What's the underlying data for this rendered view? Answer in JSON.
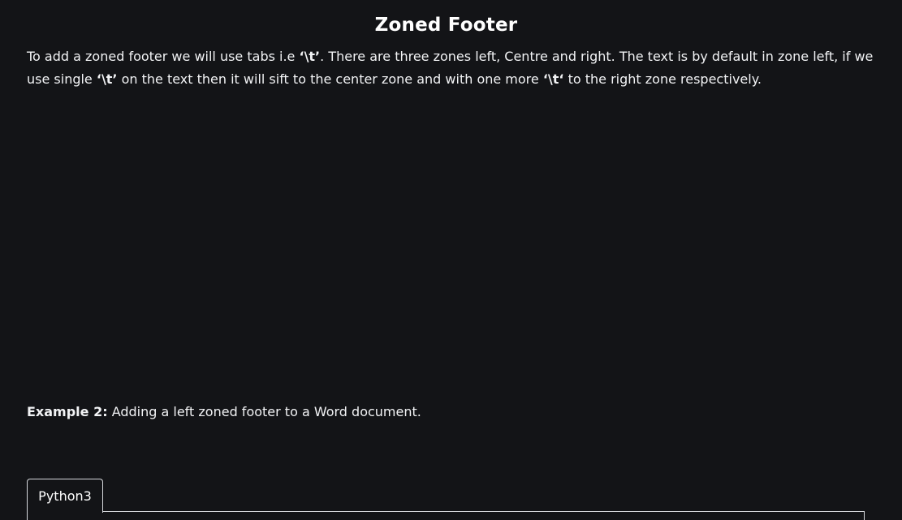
{
  "article": {
    "heading": "Zoned Footer",
    "para_1": "To add a zoned footer we will use tabs i.e ",
    "tab_code_1": "‘\\t’",
    "para_2": ". There are three zones left, Centre and right. The text is by default in zone left, if we use single ",
    "tab_code_2": "‘\\t’",
    "para_3": " on the text then it will sift to the center zone and with one more ",
    "tab_code_3": "‘\\t‘",
    "para_4": " to the right zone respectively.",
    "example_label": "Example 2:",
    "example_text": " Adding a left zoned footer to a Word document."
  },
  "code_block": {
    "tabs": [
      {
        "label": "Python3",
        "active": true
      }
    ]
  },
  "colors": {
    "background": "#131417",
    "text": "#f2f3f5",
    "tab_border": "#d6d8dc"
  }
}
